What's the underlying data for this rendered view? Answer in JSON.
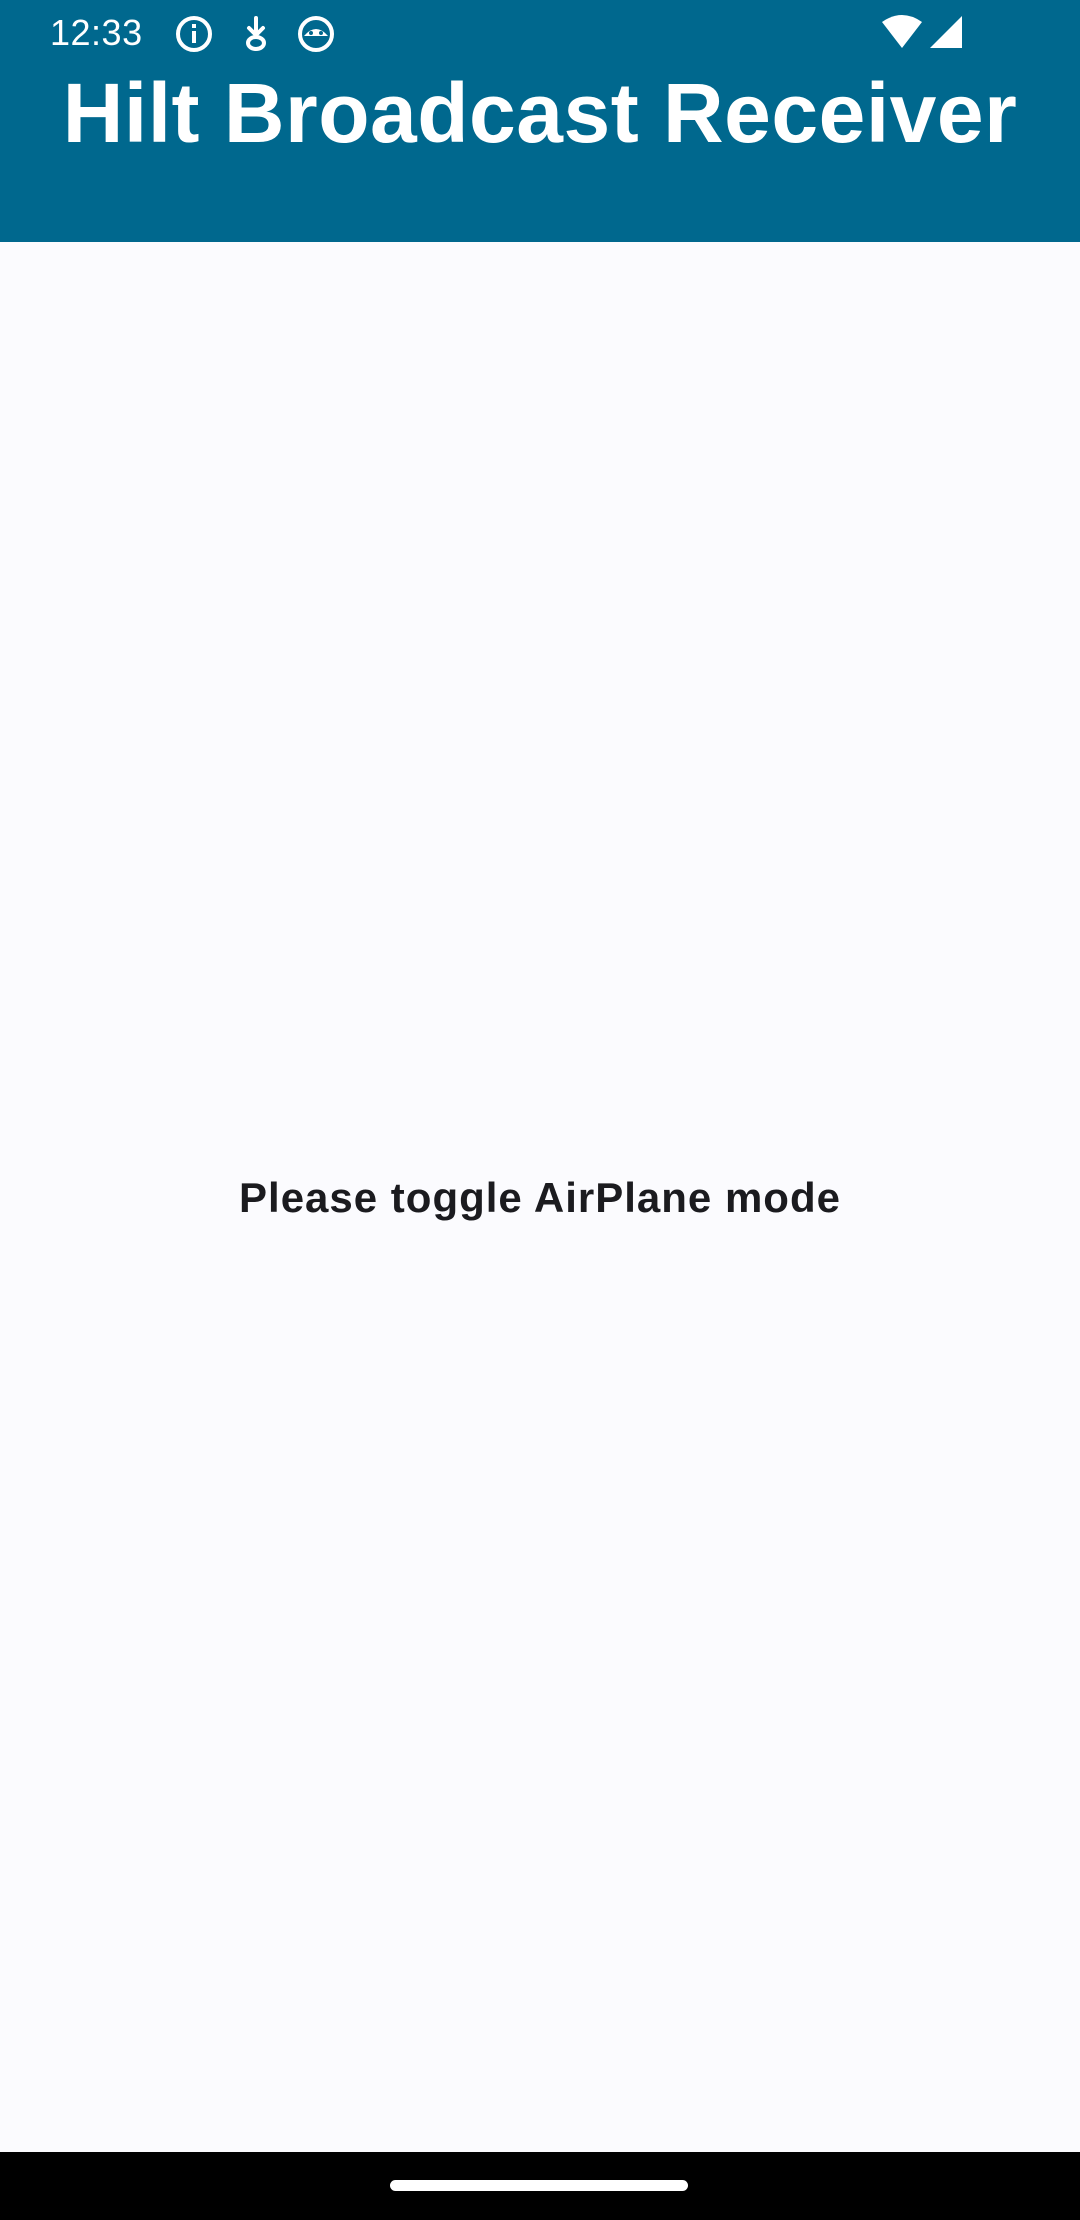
{
  "status_bar": {
    "time": "12:33",
    "icons_left": [
      "info-icon",
      "download-icon",
      "android-icon"
    ],
    "icons_right": [
      "wifi-icon",
      "cellular-signal-icon"
    ]
  },
  "app_bar": {
    "title": "Hilt Broadcast Receiver"
  },
  "main": {
    "message": "Please toggle AirPlane mode"
  },
  "colors": {
    "primary": "#00688e",
    "background": "#fbfbfe",
    "text": "#1b1b1f"
  }
}
